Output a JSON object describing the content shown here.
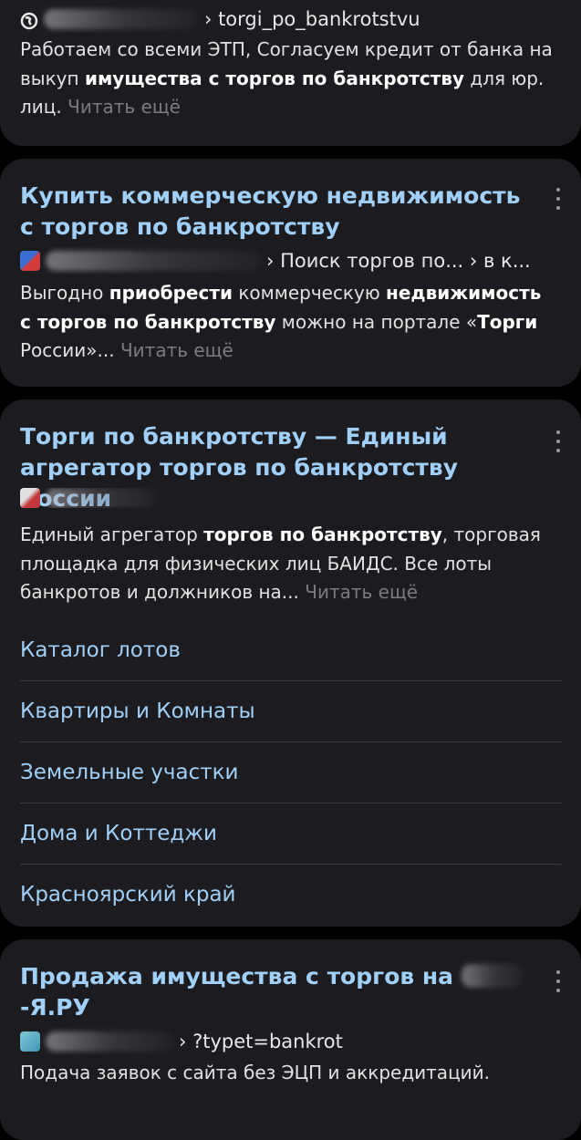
{
  "results": [
    {
      "source_path": "› torgi_po_bankrotstvu",
      "snippet_html": "Работаем со всеми ЭТП, Согласуем кредит от банка на выкуп <b>имущества с торгов по банкротству</b> для юр. лиц.",
      "read_more": "Читать ещё"
    },
    {
      "title": "Купить коммерческую недвижимость с торгов по банкротству",
      "source_path": "› Поиск торгов по... › в к...",
      "snippet_html": "Выгодно <b>приобрести</b> коммерческую <b>недвижи­мость с торгов по банкротству</b> можно на портале «<b>Торги</b> России»...",
      "read_more": "Читать ещё"
    },
    {
      "title": "Торги по банкротству — Единый агрега­тор торгов по банкротству России",
      "source_path": "",
      "snippet_html": "Единый агрегатор <b>торгов по банкротству</b>, торговая площадка для физических лиц БАИДС. Все лоты банкротов и должников на...",
      "read_more": "Читать ещё",
      "sitelinks": [
        "Каталог лотов",
        "Квартиры и Комнаты",
        "Земельные участки",
        "Дома и Коттеджи",
        "Красноярский край"
      ]
    },
    {
      "title": "Продажа имущества с торгов на ",
      "title_end": "-Я.РУ",
      "source_path": "› ?typet=bankrot",
      "snippet_html": "Подача заявок с сайта без ЭЦП и аккредитаций."
    }
  ],
  "colors": {
    "background": "#000000",
    "card": "#1c1b1f",
    "title_link": "#9fd0f9",
    "text": "#e2e2e2",
    "read_more": "#7c7c80",
    "divider": "#3a393e"
  }
}
